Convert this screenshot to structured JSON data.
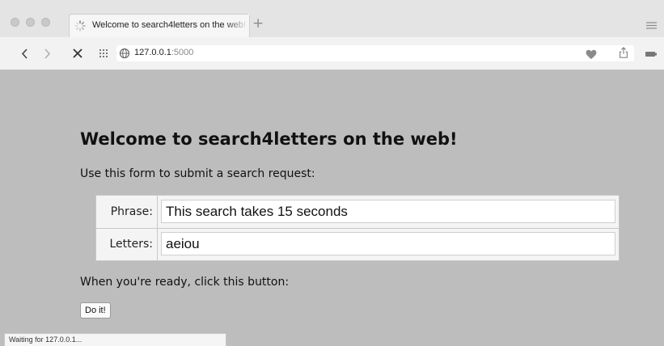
{
  "browser": {
    "tab_title": "Welcome to search4letters on the web!",
    "new_tab_symbol": "+",
    "url_host": "127.0.0.1",
    "url_port": ":5000",
    "icons": [
      "spinner-icon",
      "back-icon",
      "forward-icon",
      "stop-icon",
      "grid-icon",
      "globe-icon",
      "heart-icon",
      "share-icon",
      "battery-icon",
      "menu-icon"
    ]
  },
  "page": {
    "heading": "Welcome to search4letters on the web!",
    "intro": "Use this form to submit a search request:",
    "form": {
      "phrase_label": "Phrase:",
      "phrase_value": "This search takes 15 seconds",
      "letters_label": "Letters:",
      "letters_value": "aeiou"
    },
    "ready_text": "When you're ready, click this button:",
    "button_label": "Do it!"
  },
  "status_text": "Waiting for 127.0.0.1..."
}
